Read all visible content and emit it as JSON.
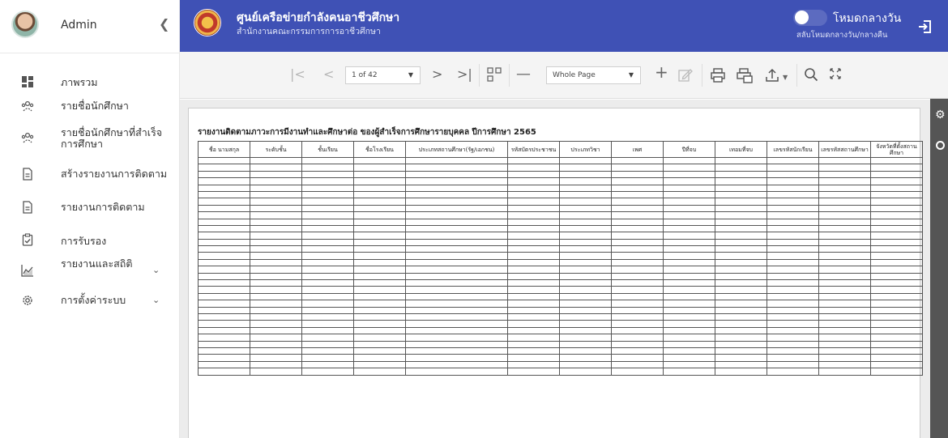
{
  "sidebar": {
    "user": {
      "name": "Admin"
    },
    "items": [
      {
        "label": "ภาพรวม",
        "icon": "dashboard-icon"
      },
      {
        "label": "รายชื่อนักศึกษา",
        "icon": "users-icon"
      },
      {
        "label": "รายชื่อนักศึกษาที่สำเร็จการศึกษา",
        "icon": "users-icon"
      },
      {
        "label": "สร้างรายงานการติดตาม",
        "icon": "document-icon"
      },
      {
        "label": "รายงานการติดตาม",
        "icon": "document-icon"
      },
      {
        "label": "การรับรอง",
        "icon": "clipboard-check-icon"
      },
      {
        "label": "รายงานและสถิติ",
        "icon": "chart-icon"
      },
      {
        "label": "การตั้งค่าระบบ",
        "icon": "gear-icon"
      }
    ]
  },
  "header": {
    "title": "ศูนย์เครือข่ายกำลังคนอาชีวศึกษา",
    "subtitle": "สำนักงานคณะกรรมการการอาชีวศึกษา",
    "mode_label": "โหมดกลางวัน",
    "mode_sub": "สลับโหมดกลางวัน/กลางคืน",
    "accent": "#3f51b5"
  },
  "toolbar": {
    "page_value": "1 of 42",
    "zoom_value": "Whole Page"
  },
  "report": {
    "title": "รายงานติดตามภาวะการมีงานทำและศึกษาต่อ ของผู้สำเร็จการศึกษารายบุคคล ปีการศึกษา 2565",
    "columns": [
      "ชื่อ นามสกุล",
      "ระดับชั้น",
      "ชั้นเรียน",
      "ชื่อโรงเรียน",
      "ประเภทสถานศึกษา(รัฐ/เอกชน)",
      "รหัสบัตรประชาชน",
      "ประเภทวิชา",
      "เพศ",
      "ปีที่จบ",
      "เทอมที่จบ",
      "เลขรหัสนักเรียน",
      "เลขรหัสสถานศึกษา",
      "จังหวัดที่ตั้งสถานศึกษา"
    ],
    "empty_rows": 32
  }
}
